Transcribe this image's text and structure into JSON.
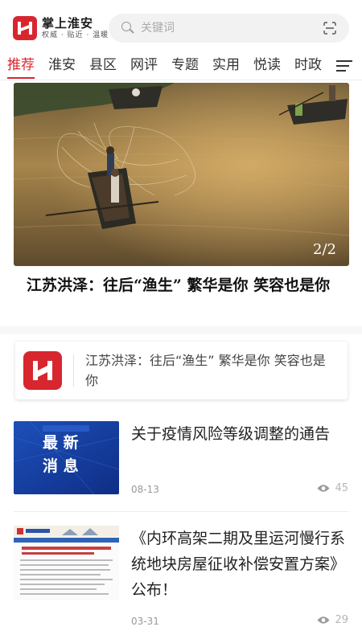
{
  "header": {
    "logo_title": "掌上淮安",
    "logo_slogan": "权威 · 贴近 · 温暖",
    "search_placeholder": "关键词"
  },
  "tabs": [
    {
      "label": "推荐",
      "active": true
    },
    {
      "label": "淮安",
      "active": false
    },
    {
      "label": "县区",
      "active": false
    },
    {
      "label": "网评",
      "active": false
    },
    {
      "label": "专题",
      "active": false
    },
    {
      "label": "实用",
      "active": false
    },
    {
      "label": "悦读",
      "active": false
    },
    {
      "label": "时政",
      "active": false
    }
  ],
  "hero": {
    "counter": "2/2",
    "title": "江苏洪泽：往后“渔生” 繁华是你 笑容也是你"
  },
  "account_card": {
    "text": "江苏洪泽：往后“渔生” 繁华是你 笑容也是你"
  },
  "news": [
    {
      "title": "关于疫情风险等级调整的通告",
      "date": "08-13",
      "views": "45",
      "thumb_banner": "最新消息",
      "thumb_line1": "最 新",
      "thumb_line2": "消 息"
    },
    {
      "title": "《内环高架二期及里运河慢行系统地块房屋征收补偿安置方案》公布！",
      "date": "03-31",
      "views": "29"
    }
  ],
  "colors": {
    "accent": "#d8262f",
    "text_primary": "#222222",
    "text_muted": "#999999"
  },
  "icons": [
    "search-icon",
    "scan-icon",
    "menu-icon",
    "eye-icon",
    "logo-icon"
  ]
}
